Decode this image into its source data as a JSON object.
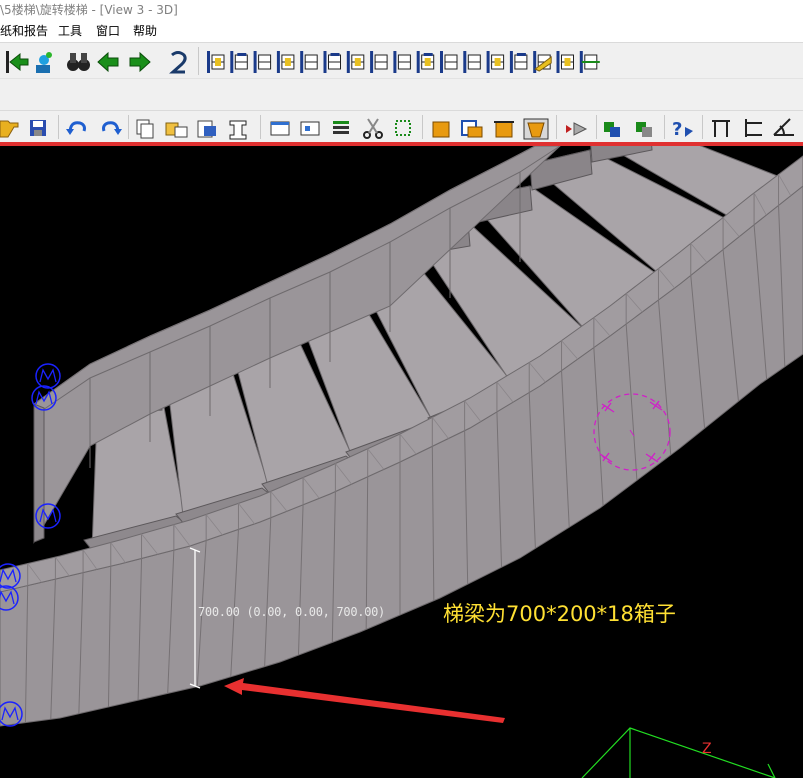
{
  "window": {
    "title": "\\5楼梯\\旋转楼梯 - [View 3 - 3D]"
  },
  "menu": {
    "items": [
      {
        "label": "纸和报告"
      },
      {
        "label": "工具"
      },
      {
        "label": "窗口"
      },
      {
        "label": "帮助"
      }
    ]
  },
  "toolbar_top": {
    "icons": [
      "back-arrow-icon",
      "camera-icon",
      "binoculars-icon",
      "arrow-left-icon",
      "arrow-right-icon",
      "number-2-icon",
      "column-plate-icon",
      "beam-end-icon",
      "cap-plate-icon",
      "end-plate-icon",
      "shear-plate-icon",
      "tee-plate-icon",
      "stiffener-icon",
      "web-plate-icon",
      "seat-icon",
      "splice-icon",
      "flange-plate-icon",
      "moment-plate-icon",
      "gusset-plate-icon",
      "bolt-plate-icon",
      "pin-plate-icon",
      "brace-connection-icon",
      "anchor-icon"
    ]
  },
  "toolbar_bottom": {
    "icons": [
      "open-folder-icon",
      "save-icon",
      "undo-icon",
      "redo-icon",
      "copy-icon",
      "move-icon",
      "paste-icon",
      "profile-icon",
      "window-icon",
      "view-icon",
      "list-icon",
      "scissors-icon",
      "select-icon",
      "part-icon",
      "assembly-icon",
      "cut-icon",
      "fit-icon",
      "arrow-red-icon",
      "component-icon",
      "component2-icon",
      "help-icon",
      "dimension-h-icon",
      "dimension-v-icon",
      "dimension-angle-icon"
    ]
  },
  "viewport": {
    "dimension_label": "700.00 (0.00, 0.00, 700.00)",
    "annotation": "梯梁为700*200*18箱子",
    "axis_label": "Z",
    "colors": {
      "background": "#000000",
      "stair_face": "#9a9599",
      "stair_top": "#a9a4a8",
      "annotation": "#ffe033",
      "arrow": "#e83030",
      "marker": "#1a22ff",
      "circle": "#d020c8",
      "axis": "#22dd22"
    }
  }
}
